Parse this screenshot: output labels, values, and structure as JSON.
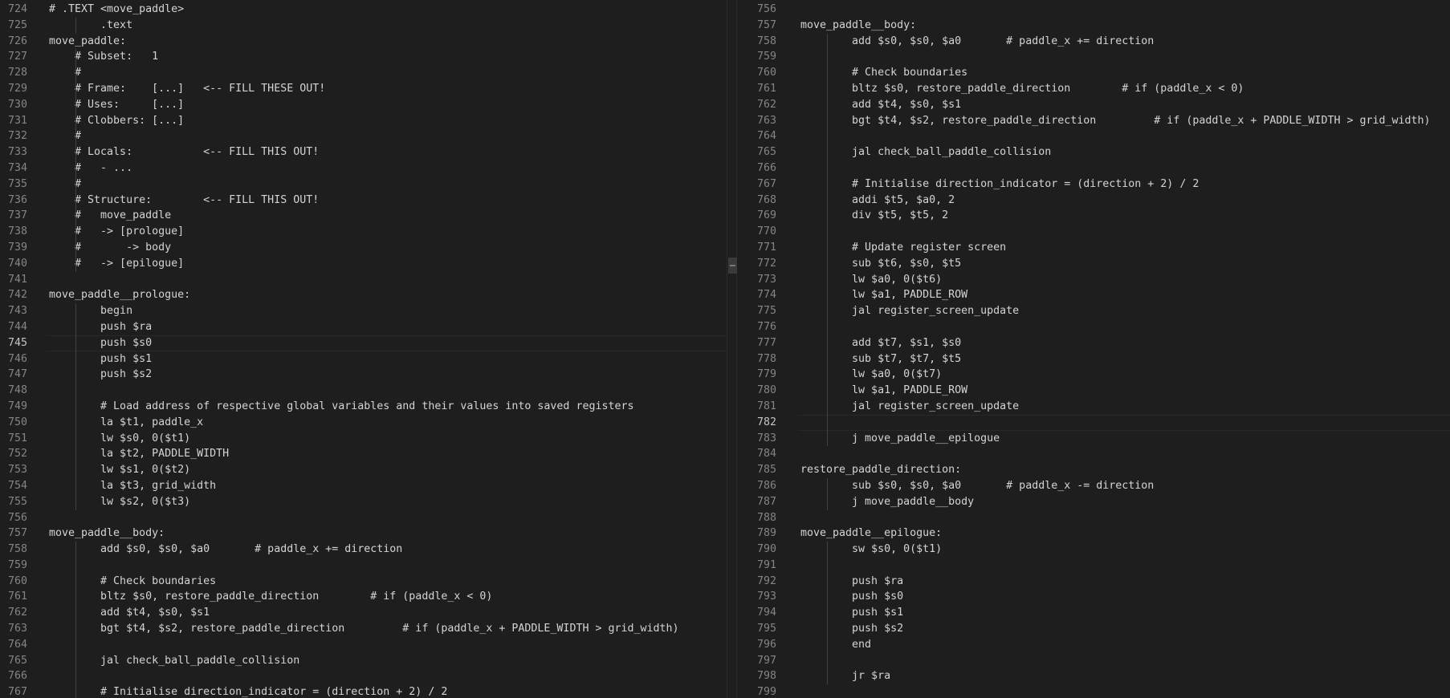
{
  "editor": {
    "left_pane": {
      "active_line": "745",
      "lines": [
        {
          "n": "724",
          "t": "# .TEXT <move_paddle>"
        },
        {
          "n": "725",
          "t": "        .text"
        },
        {
          "n": "726",
          "t": "move_paddle:"
        },
        {
          "n": "727",
          "t": "    # Subset:   1"
        },
        {
          "n": "728",
          "t": "    #"
        },
        {
          "n": "729",
          "t": "    # Frame:    [...]   <-- FILL THESE OUT!"
        },
        {
          "n": "730",
          "t": "    # Uses:     [...]"
        },
        {
          "n": "731",
          "t": "    # Clobbers: [...]"
        },
        {
          "n": "732",
          "t": "    #"
        },
        {
          "n": "733",
          "t": "    # Locals:           <-- FILL THIS OUT!"
        },
        {
          "n": "734",
          "t": "    #   - ..."
        },
        {
          "n": "735",
          "t": "    #"
        },
        {
          "n": "736",
          "t": "    # Structure:        <-- FILL THIS OUT!"
        },
        {
          "n": "737",
          "t": "    #   move_paddle"
        },
        {
          "n": "738",
          "t": "    #   -> [prologue]"
        },
        {
          "n": "739",
          "t": "    #       -> body"
        },
        {
          "n": "740",
          "t": "    #   -> [epilogue]"
        },
        {
          "n": "741",
          "t": ""
        },
        {
          "n": "742",
          "t": "move_paddle__prologue:"
        },
        {
          "n": "743",
          "t": "        begin"
        },
        {
          "n": "744",
          "t": "        push $ra"
        },
        {
          "n": "745",
          "t": "        push $s0"
        },
        {
          "n": "746",
          "t": "        push $s1"
        },
        {
          "n": "747",
          "t": "        push $s2"
        },
        {
          "n": "748",
          "t": ""
        },
        {
          "n": "749",
          "t": "        # Load address of respective global variables and their values into saved registers"
        },
        {
          "n": "750",
          "t": "        la $t1, paddle_x"
        },
        {
          "n": "751",
          "t": "        lw $s0, 0($t1)"
        },
        {
          "n": "752",
          "t": "        la $t2, PADDLE_WIDTH"
        },
        {
          "n": "753",
          "t": "        lw $s1, 0($t2)"
        },
        {
          "n": "754",
          "t": "        la $t3, grid_width"
        },
        {
          "n": "755",
          "t": "        lw $s2, 0($t3)"
        },
        {
          "n": "756",
          "t": ""
        },
        {
          "n": "757",
          "t": "move_paddle__body:"
        },
        {
          "n": "758",
          "t": "        add $s0, $s0, $a0       # paddle_x += direction"
        },
        {
          "n": "759",
          "t": ""
        },
        {
          "n": "760",
          "t": "        # Check boundaries"
        },
        {
          "n": "761",
          "t": "        bltz $s0, restore_paddle_direction        # if (paddle_x < 0)"
        },
        {
          "n": "762",
          "t": "        add $t4, $s0, $s1"
        },
        {
          "n": "763",
          "t": "        bgt $t4, $s2, restore_paddle_direction         # if (paddle_x + PADDLE_WIDTH > grid_width)"
        },
        {
          "n": "764",
          "t": ""
        },
        {
          "n": "765",
          "t": "        jal check_ball_paddle_collision"
        },
        {
          "n": "766",
          "t": ""
        },
        {
          "n": "767",
          "t": "        # Initialise direction_indicator = (direction + 2) / 2"
        }
      ]
    },
    "right_pane": {
      "active_line": "782",
      "lines": [
        {
          "n": "756",
          "t": ""
        },
        {
          "n": "757",
          "t": "move_paddle__body:"
        },
        {
          "n": "758",
          "t": "        add $s0, $s0, $a0       # paddle_x += direction"
        },
        {
          "n": "759",
          "t": ""
        },
        {
          "n": "760",
          "t": "        # Check boundaries"
        },
        {
          "n": "761",
          "t": "        bltz $s0, restore_paddle_direction        # if (paddle_x < 0)"
        },
        {
          "n": "762",
          "t": "        add $t4, $s0, $s1"
        },
        {
          "n": "763",
          "t": "        bgt $t4, $s2, restore_paddle_direction         # if (paddle_x + PADDLE_WIDTH > grid_width)"
        },
        {
          "n": "764",
          "t": ""
        },
        {
          "n": "765",
          "t": "        jal check_ball_paddle_collision"
        },
        {
          "n": "766",
          "t": ""
        },
        {
          "n": "767",
          "t": "        # Initialise direction_indicator = (direction + 2) / 2"
        },
        {
          "n": "768",
          "t": "        addi $t5, $a0, 2"
        },
        {
          "n": "769",
          "t": "        div $t5, $t5, 2"
        },
        {
          "n": "770",
          "t": ""
        },
        {
          "n": "771",
          "t": "        # Update register screen"
        },
        {
          "n": "772",
          "t": "        sub $t6, $s0, $t5"
        },
        {
          "n": "773",
          "t": "        lw $a0, 0($t6)"
        },
        {
          "n": "774",
          "t": "        lw $a1, PADDLE_ROW"
        },
        {
          "n": "775",
          "t": "        jal register_screen_update"
        },
        {
          "n": "776",
          "t": ""
        },
        {
          "n": "777",
          "t": "        add $t7, $s1, $s0"
        },
        {
          "n": "778",
          "t": "        sub $t7, $t7, $t5"
        },
        {
          "n": "779",
          "t": "        lw $a0, 0($t7)"
        },
        {
          "n": "780",
          "t": "        lw $a1, PADDLE_ROW"
        },
        {
          "n": "781",
          "t": "        jal register_screen_update"
        },
        {
          "n": "782",
          "t": ""
        },
        {
          "n": "783",
          "t": "        j move_paddle__epilogue"
        },
        {
          "n": "784",
          "t": ""
        },
        {
          "n": "785",
          "t": "restore_paddle_direction:"
        },
        {
          "n": "786",
          "t": "        sub $s0, $s0, $a0       # paddle_x -= direction"
        },
        {
          "n": "787",
          "t": "        j move_paddle__body"
        },
        {
          "n": "788",
          "t": ""
        },
        {
          "n": "789",
          "t": "move_paddle__epilogue:"
        },
        {
          "n": "790",
          "t": "        sw $s0, 0($t1)"
        },
        {
          "n": "791",
          "t": ""
        },
        {
          "n": "792",
          "t": "        push $ra"
        },
        {
          "n": "793",
          "t": "        push $s0"
        },
        {
          "n": "794",
          "t": "        push $s1"
        },
        {
          "n": "795",
          "t": "        push $s2"
        },
        {
          "n": "796",
          "t": "        end"
        },
        {
          "n": "797",
          "t": ""
        },
        {
          "n": "798",
          "t": "        jr $ra"
        },
        {
          "n": "799",
          "t": ""
        }
      ]
    }
  },
  "colors": {
    "background": "#1e1e1e",
    "text": "#d4d4d4",
    "line_number": "#858585",
    "active_line_number": "#c6c6c6",
    "indent_guide": "#404040"
  }
}
